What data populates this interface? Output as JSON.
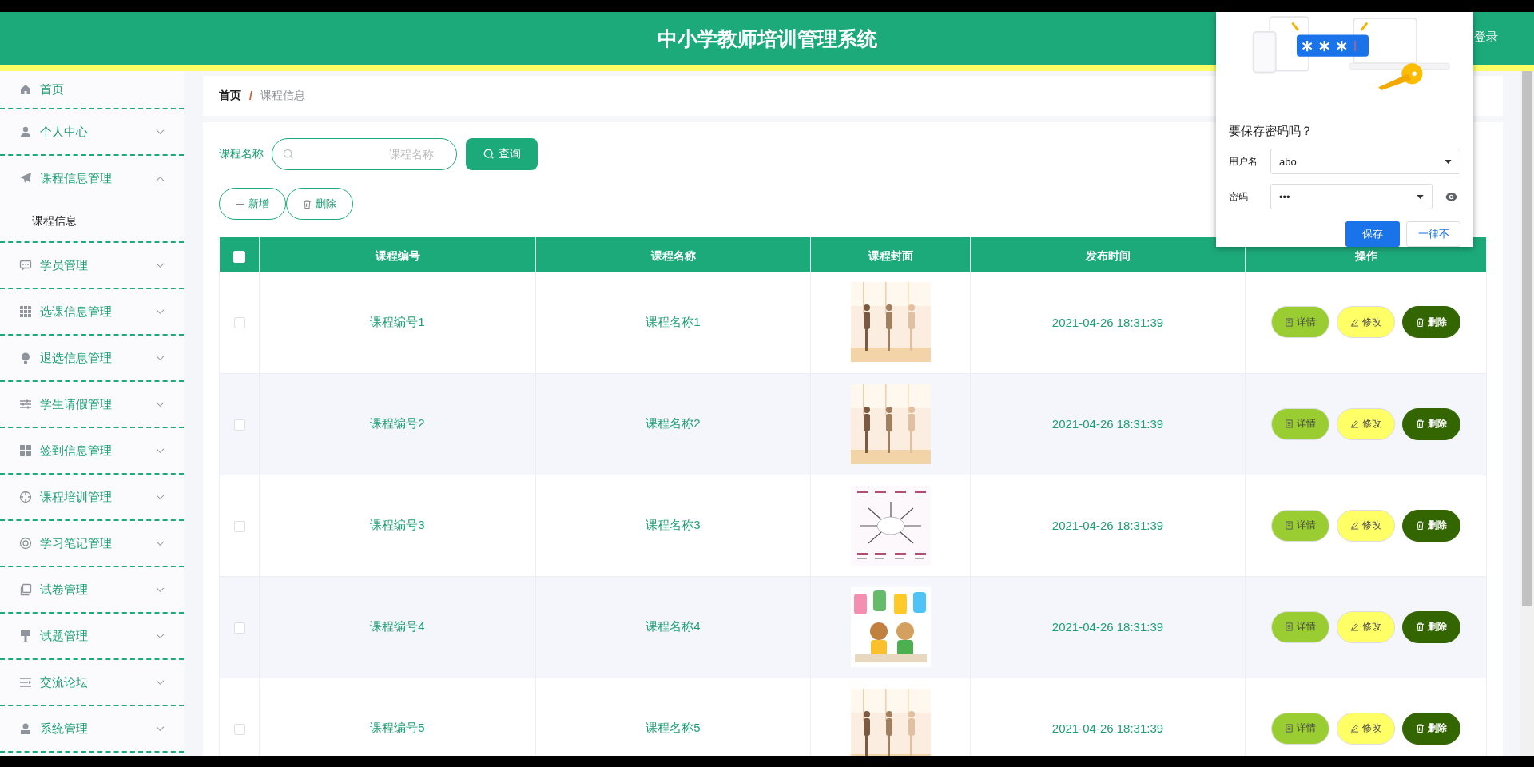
{
  "header": {
    "title": "中小学教师培训管理系统",
    "login": "登录"
  },
  "sidebar": {
    "items": [
      {
        "label": "首页"
      },
      {
        "label": "个人中心",
        "expanded": false
      },
      {
        "label": "课程信息管理",
        "expanded": true,
        "children": [
          {
            "label": "课程信息"
          }
        ]
      },
      {
        "label": "学员管理",
        "expanded": false
      },
      {
        "label": "选课信息管理",
        "expanded": false
      },
      {
        "label": "退选信息管理",
        "expanded": false
      },
      {
        "label": "学生请假管理",
        "expanded": false
      },
      {
        "label": "签到信息管理",
        "expanded": false
      },
      {
        "label": "课程培训管理",
        "expanded": false
      },
      {
        "label": "学习笔记管理",
        "expanded": false
      },
      {
        "label": "试卷管理",
        "expanded": false
      },
      {
        "label": "试题管理",
        "expanded": false
      },
      {
        "label": "交流论坛",
        "expanded": false
      },
      {
        "label": "系统管理",
        "expanded": false
      }
    ]
  },
  "breadcrumb": {
    "home": "首页",
    "separator": "/",
    "current": "课程信息"
  },
  "search": {
    "label": "课程名称",
    "placeholder": "课程名称",
    "button": "查询"
  },
  "toolbar": {
    "add": "新增",
    "delete": "删除"
  },
  "table": {
    "select_all": {
      "checked": false
    },
    "columns": [
      "课程编号",
      "课程名称",
      "课程封面",
      "发布时间",
      "操作"
    ],
    "rows": [
      {
        "checked": false,
        "code": "课程编号1",
        "name": "课程名称1",
        "time": "2021-04-26 18:31:39",
        "actions": [
          "详情",
          "修改",
          "删除"
        ]
      },
      {
        "checked": false,
        "code": "课程编号2",
        "name": "课程名称2",
        "time": "2021-04-26 18:31:39",
        "actions": [
          "详情",
          "修改",
          "删除"
        ]
      },
      {
        "checked": false,
        "code": "课程编号3",
        "name": "课程名称3",
        "time": "2021-04-26 18:31:39",
        "actions": [
          "详情",
          "修改",
          "删除"
        ]
      },
      {
        "checked": false,
        "code": "课程编号4",
        "name": "课程名称4",
        "time": "2021-04-26 18:31:39",
        "actions": [
          "详情",
          "修改",
          "删除"
        ]
      },
      {
        "checked": false,
        "code": "课程编号5",
        "name": "课程名称5",
        "time": "2021-04-26 18:31:39",
        "actions": [
          "详情",
          "修改",
          "删除"
        ]
      }
    ]
  },
  "password_popup": {
    "question": "要保存密码吗？",
    "username_label": "用户名",
    "username": "abo",
    "password_label": "密码",
    "password": "•••",
    "save": "保存",
    "never": "一律不"
  }
}
